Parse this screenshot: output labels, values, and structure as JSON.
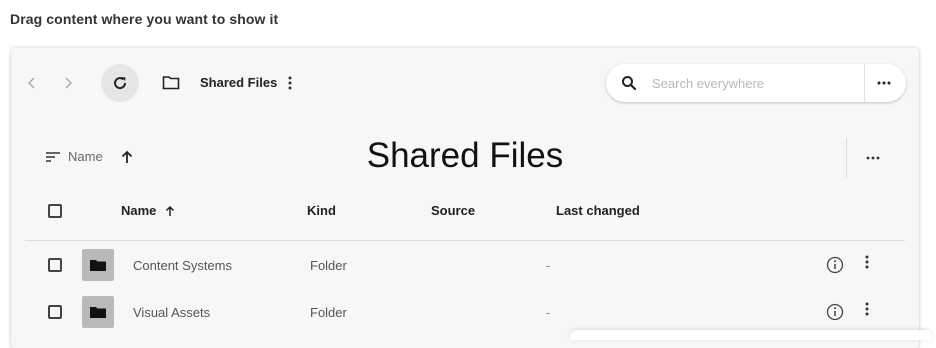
{
  "hint": "Drag content where you want to show it",
  "toolbar": {
    "breadcrumb_title": "Shared Files",
    "search_placeholder": "Search everywhere"
  },
  "header": {
    "sort_label": "Name",
    "title": "Shared Files"
  },
  "columns": {
    "name": "Name",
    "kind": "Kind",
    "source": "Source",
    "last_changed": "Last changed"
  },
  "rows": [
    {
      "name": "Content Systems",
      "kind": "Folder",
      "source": "",
      "last_changed": "-"
    },
    {
      "name": "Visual Assets",
      "kind": "Folder",
      "source": "",
      "last_changed": "-"
    }
  ],
  "icons": {
    "back": "chevron-left-icon",
    "forward": "chevron-right-icon",
    "refresh": "refresh-icon",
    "folder": "folder-icon",
    "more": "more-vertical-icon",
    "search": "search-icon",
    "more_horizontal": "more-horizontal-icon",
    "sort": "sort-lines-icon",
    "arrow_up": "arrow-up-icon",
    "info": "info-icon"
  },
  "colors": {
    "panel_bg": "#f7f7f7",
    "thumb_bg": "#b9b9b9",
    "refresh_bg": "#e6e6e6"
  }
}
